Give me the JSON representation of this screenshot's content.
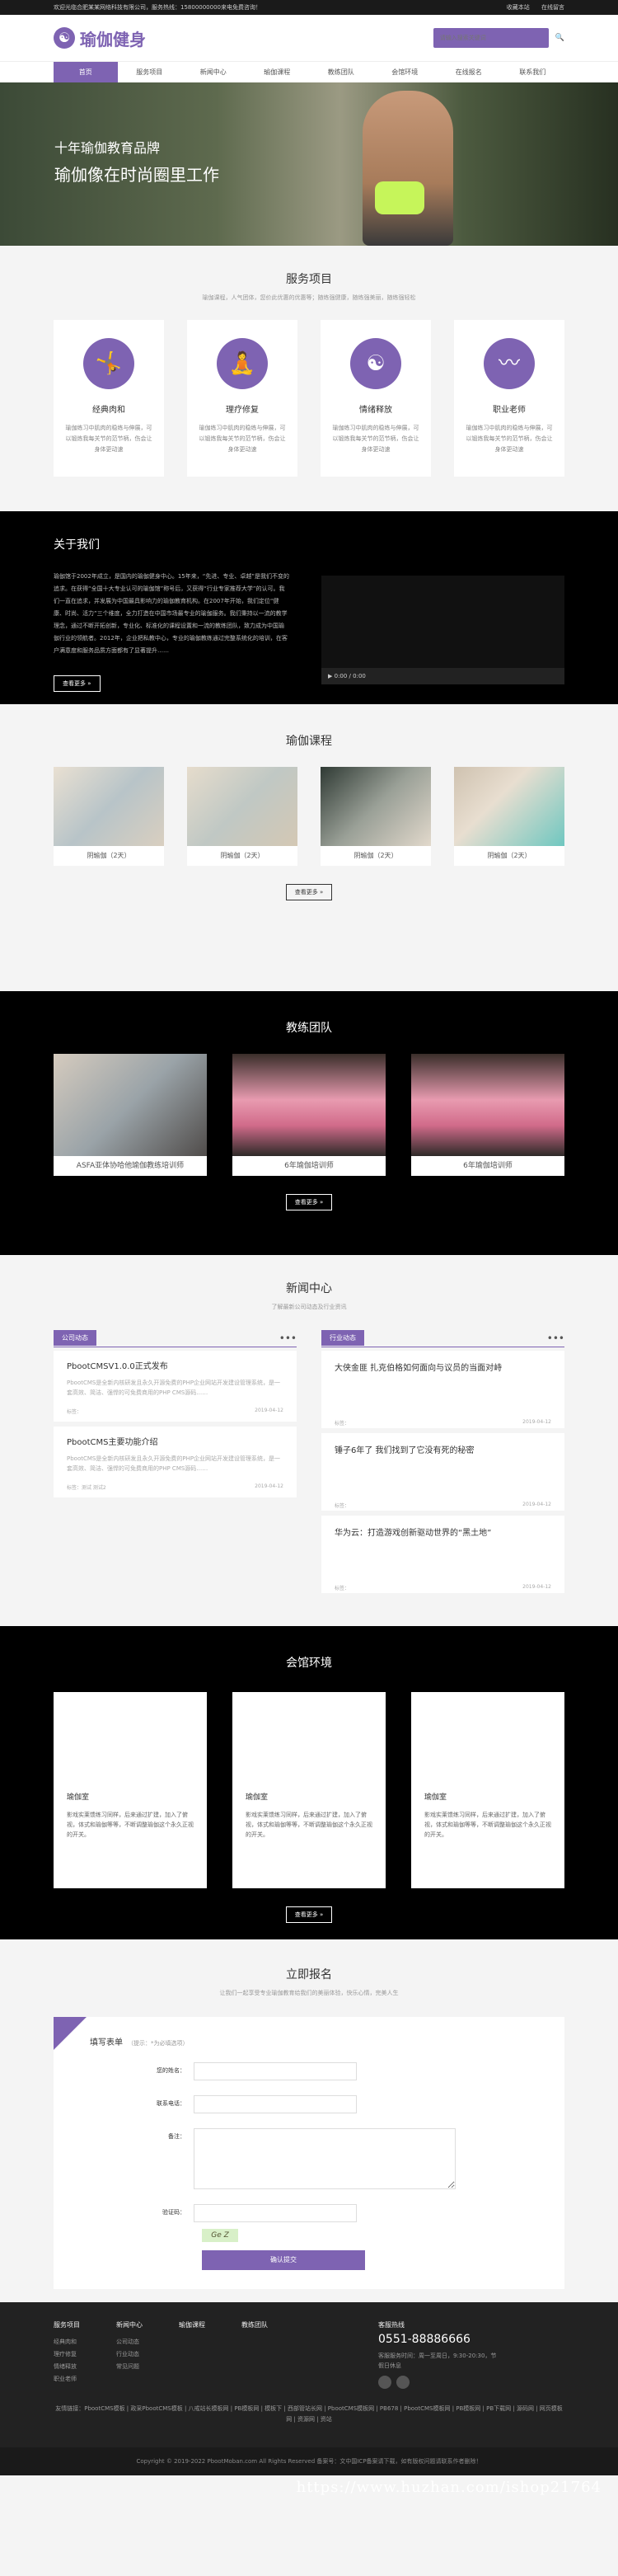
{
  "topbar": {
    "welcome": "欢迎光临合肥某某网络科技有限公司，服务热线：15800000000来电免费咨询！",
    "fav": "收藏本站",
    "online": "在线留言"
  },
  "header": {
    "logo_text": "瑜伽健身",
    "search_placeholder": "请输入搜索关键词"
  },
  "nav": [
    "首页",
    "服务项目",
    "新闻中心",
    "瑜伽课程",
    "教练团队",
    "会馆环境",
    "在线报名",
    "联系我们"
  ],
  "banner": {
    "line1": "十年瑜伽教育品牌",
    "line2": "瑜伽像在时尚圈里工作"
  },
  "services": {
    "title": "服务项目",
    "sub": "瑜伽课程，人气团体，您价此优惠的优惠等；随练强健康，随练强美丽，随练强轻松",
    "items": [
      {
        "name": "经典肉和",
        "desc": "瑜伽练习中肌肉的稳练与伸展，可以锻炼我每关节的范节柄，伤会让身体更动速",
        "icon": "yoga-pose-icon"
      },
      {
        "name": "理疗修复",
        "desc": "瑜伽练习中肌肉的稳练与伸展，可以锻炼我每关节的范节柄，伤会让身体更动速",
        "icon": "stretch-icon"
      },
      {
        "name": "情绪释放",
        "desc": "瑜伽练习中肌肉的稳练与伸展，可以锻炼我每关节的范节柄，伤会让身体更动速",
        "icon": "meditation-icon"
      },
      {
        "name": "职业老师",
        "desc": "瑜伽练习中肌肉的稳练与伸展，可以锻炼我每关节的范节柄，伤会让身体更动速",
        "icon": "wave-icon"
      }
    ]
  },
  "about": {
    "title": "关于我们",
    "text": "瑜伽馆于2002年成立，是国内的瑜伽健身中心。15年来，“先进、专业、卓越”是我们不变的追求。在获得“全国十大专业认可的瑜伽馆”称号后，又获得“行业专家推荐大学”的认可。我们一直在追求，并发展为中国最具影响力的瑜伽教育机构。在2007年开始，我们定位“健康、时尚、活力”三个维度，全力打造在中国市场最专业的瑜伽服务。我们秉持以一流的教学理念，通过不断开拓创新，专业化、标准化的课程设置和一流的教练团队，致力成为中国瑜伽行业的领航者。2012年，企业把私教中心，专业的瑜伽教练通过完整系统化的培训，在客户满意度和服务品质方面都有了显著提升……",
    "video_time": "0:00 / 0:00",
    "more": "查看更多"
  },
  "courses": {
    "title": "瑜伽课程",
    "items": [
      "阴瑜伽（2天）",
      "阴瑜伽（2天）",
      "阴瑜伽（2天）",
      "阴瑜伽（2天）"
    ],
    "more": "查看更多"
  },
  "coaches": {
    "title": "教练团队",
    "items": [
      "ASFA亚体协哈他瑜伽教练培训师",
      "6年瑜伽培训师",
      "6年瑜伽培训师"
    ],
    "more": "查看更多"
  },
  "news": {
    "title": "新闻中心",
    "sub": "了解最新公司动态及行业资讯",
    "left": {
      "tag": "公司动态",
      "items": [
        {
          "title": "PbootCMSV1.0.0正式发布",
          "desc": "PbootCMS是全新内核研发且永久开源免费的PHP企业网站开发建设管理系统，是一套高效、简洁、强悍的可免费商用的PHP CMS源码……",
          "meta": "标签：",
          "date": "2019-04-12"
        },
        {
          "title": "PbootCMS主要功能介绍",
          "desc": "PbootCMS是全新内核研发且永久开源免费的PHP企业网站开发建设管理系统，是一套高效、简洁、强悍的可免费商用的PHP CMS源码……",
          "meta": "标签：测试 测试2",
          "date": "2019-04-12"
        }
      ]
    },
    "right": {
      "tag": "行业动态",
      "items": [
        {
          "title": "大侠金匪 扎克伯格如何面向与议员的当面对峙",
          "meta": "标签：",
          "date": "2019-04-12"
        },
        {
          "title": "锤子6年了 我们找到了它没有死的秘密",
          "meta": "标签：",
          "date": "2019-04-12"
        },
        {
          "title": "华为云：打造游戏创新驱动世界的“黑土地”",
          "meta": "标签：",
          "date": "2019-04-12"
        }
      ]
    }
  },
  "env": {
    "title": "会馆环境",
    "items": [
      {
        "name": "瑜伽室",
        "desc": "影戏实莱馈练习同样，后来通过扩建，加入了俯视，体式和瑜伽等等，不断调整瑜伽这个永久正视的开关。"
      },
      {
        "name": "瑜伽室",
        "desc": "影戏实莱馈练习同样，后来通过扩建，加入了俯视，体式和瑜伽等等，不断调整瑜伽这个永久正视的开关。"
      },
      {
        "name": "瑜伽室",
        "desc": "影戏实莱馈练习同样，后来通过扩建，加入了俯视，体式和瑜伽等等，不断调整瑜伽这个永久正视的开关。"
      }
    ],
    "more": "查看更多"
  },
  "register": {
    "title": "立即报名",
    "sub": "让我们一起享受专业瑜伽教育给我们的美丽体验，快乐心情，完美人生",
    "form_title": "填写表单",
    "form_hint": "（提示：*为必填选项）",
    "labels": [
      "您的姓名：",
      "联系电话：",
      "备注：",
      "验证码："
    ],
    "captcha": "Ge Z",
    "submit": "确认提交"
  },
  "footer": {
    "cols": [
      {
        "title": "服务项目",
        "items": [
          "经典肉和",
          "理疗修复",
          "情绪释放",
          "职业老师"
        ]
      },
      {
        "title": "新闻中心",
        "items": [
          "公司动态",
          "行业动态",
          "常见问题"
        ]
      },
      {
        "title": "瑜伽课程",
        "items": []
      },
      {
        "title": "教练团队",
        "items": []
      }
    ],
    "contact_title": "客服热线",
    "phone": "0551-88886666",
    "hours": "客服服务时间：周一至周日，9:30-20:30，节假日休息",
    "links": "友情链接：PbootCMS模板 | 政采PbootCMS模板 | 八戒站长模板网 | PB模板网 | 模板下 | 西部管站长网 | PbootCMS模板网 | PB678 | PbootCMS模板网 | PB模板网 | PB下载网 | 源码网 | 网页模板网 | 资源网 | 资站",
    "copyright": "Copyright © 2019-2022 PbootMoban.com All Rights Reserved 备案号：文中国ICP备案请下载，如有版权问题请联系作者删除！"
  },
  "watermark": "https://www.huzhan.com/ishop21764"
}
